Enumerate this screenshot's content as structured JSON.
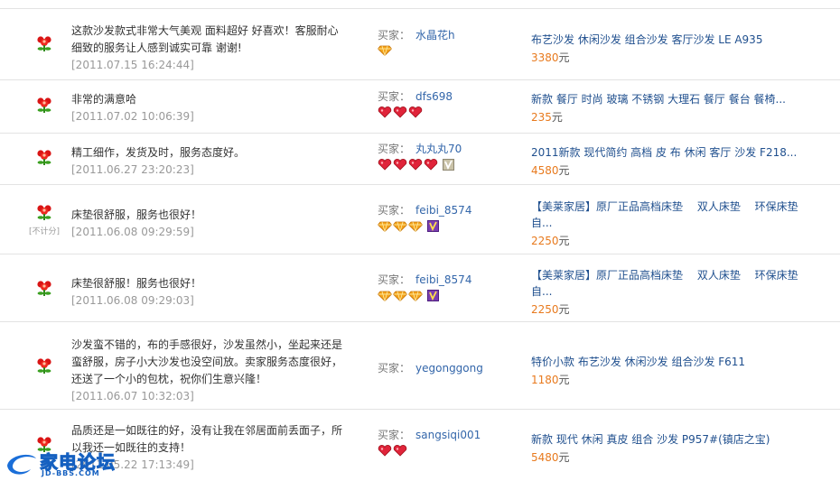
{
  "reviews": [
    {
      "text": "这款沙发款式非常大气美观 面料超好 好喜欢！客服耐心细致的服务让人感到诚实可靠 谢谢!",
      "time": "[2011.07.15 16:24:44]",
      "buyer_label": "买家：",
      "buyer_name": "水晶花h",
      "badges": [
        "diamond"
      ],
      "product": "布艺沙发 休闲沙发 组合沙发 客厅沙发 LE A935",
      "price": "3380",
      "unit": "元",
      "no_score": ""
    },
    {
      "text": "非常的满意哈",
      "time": "[2011.07.02 10:06:39]",
      "buyer_label": "买家：",
      "buyer_name": "dfs698",
      "badges": [
        "heart",
        "heart",
        "heart"
      ],
      "product": "新款 餐厅 时尚 玻璃 不锈钢 大理石 餐厅 餐台 餐椅...",
      "price": "235",
      "unit": "元",
      "no_score": ""
    },
    {
      "text": "精工细作，发货及时，服务态度好。",
      "time": "[2011.06.27 23:20:23]",
      "buyer_label": "买家：",
      "buyer_name": "丸丸丸70",
      "badges": [
        "heart",
        "heart",
        "heart",
        "heart",
        "v-gray"
      ],
      "product": "2011新款 现代简约 高档 皮 布 休闲 客厅 沙发 F218...",
      "price": "4580",
      "unit": "元",
      "no_score": ""
    },
    {
      "text": "床垫很舒服，服务也很好！",
      "time": "[2011.06.08 09:29:59]",
      "buyer_label": "买家：",
      "buyer_name": "feibi_8574",
      "badges": [
        "diamond",
        "diamond",
        "diamond",
        "v-purple"
      ],
      "product": "【美莱家居】原厂正品高档床垫　 双人床垫　 环保床垫 自...",
      "price": "2250",
      "unit": "元",
      "no_score": "[不计分]"
    },
    {
      "text": "床垫很舒服！服务也很好！",
      "time": "[2011.06.08 09:29:03]",
      "buyer_label": "买家：",
      "buyer_name": "feibi_8574",
      "badges": [
        "diamond",
        "diamond",
        "diamond",
        "v-purple"
      ],
      "product": "【美莱家居】原厂正品高档床垫　 双人床垫　 环保床垫 自...",
      "price": "2250",
      "unit": "元",
      "no_score": ""
    },
    {
      "text": "沙发蛮不错的，布的手感很好，沙发虽然小，坐起来还是蛮舒服，房子小大沙发也没空间放。卖家服务态度很好，还送了一个小的包枕，祝你们生意兴隆！",
      "time": "[2011.06.07 10:32:03]",
      "buyer_label": "买家：",
      "buyer_name": "yegonggong",
      "badges": [],
      "product": "特价小款 布艺沙发 休闲沙发 组合沙发 F611",
      "price": "1180",
      "unit": "元",
      "no_score": ""
    },
    {
      "text": "品质还是一如既往的好，没有让我在邻居面前丢面子，所以我还一如既往的支持！",
      "time": "[2011.05.22 17:13:49]",
      "buyer_label": "买家：",
      "buyer_name": "sangsiqi001",
      "badges": [
        "heart",
        "heart"
      ],
      "product": "新款 现代 休闲 真皮 组合 沙发 P957#(镇店之宝)",
      "price": "5480",
      "unit": "元",
      "no_score": ""
    }
  ],
  "watermark": {
    "cn": "家电论坛",
    "en": "JD-BBS.COM"
  },
  "colors": {
    "link": "#1f4f8e",
    "buyer": "#3366aa",
    "price": "#e87a1e",
    "time": "#999999"
  }
}
